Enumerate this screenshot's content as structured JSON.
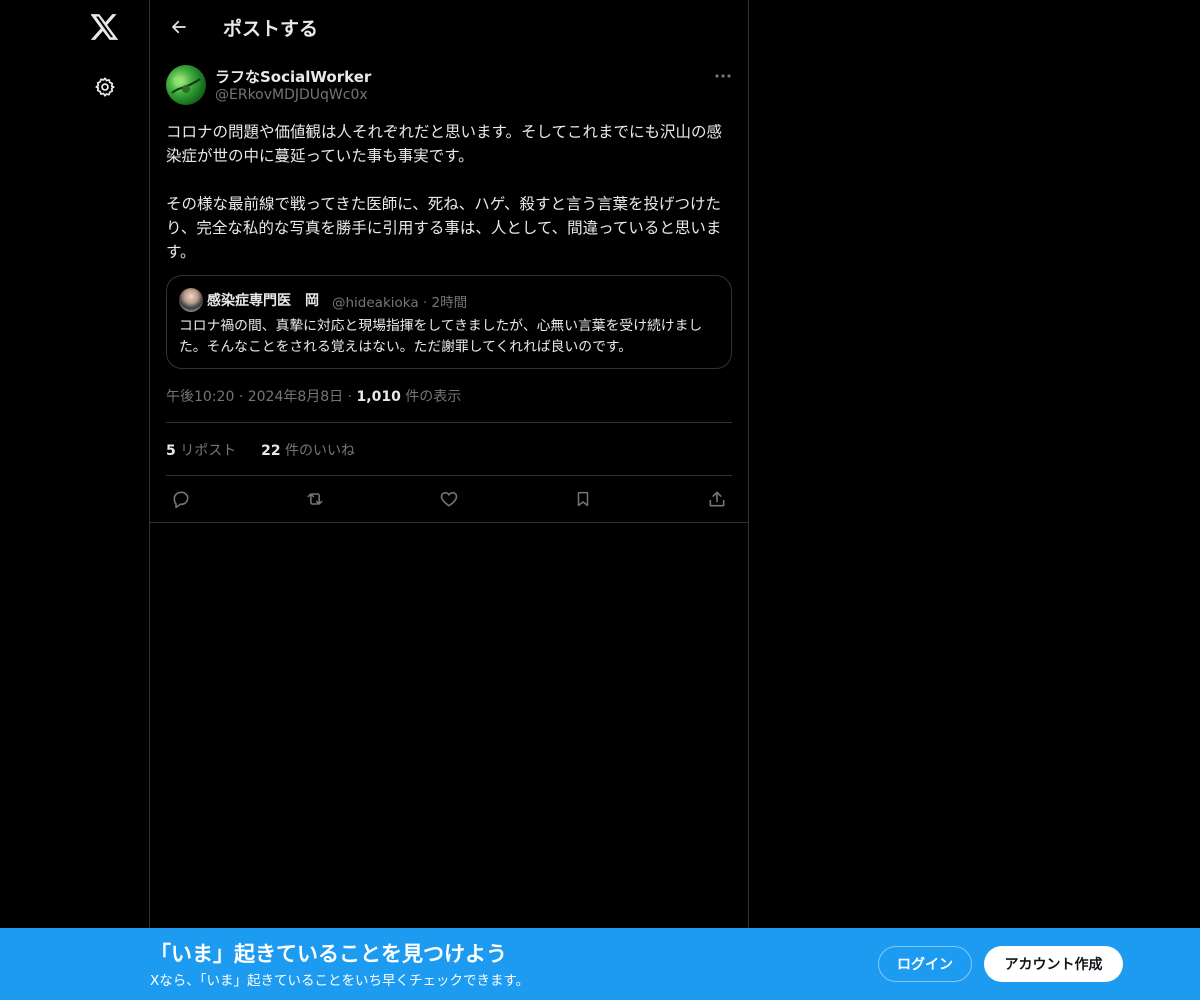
{
  "header": {
    "title": "ポストする"
  },
  "post": {
    "display_name": "ラフなSocialWorker",
    "handle": "@ERkovMDJDUqWc0x",
    "text": "コロナの問題や価値観は人それぞれだと思います。そしてこれまでにも沢山の感染症が世の中に蔓延っていた事も事実です。\n\nその様な最前線で戦ってきた医師に、死ね、ハゲ、殺すと言う言葉を投げつけたり、完全な私的な写真を勝手に引用する事は、人として、間違っていると思います。",
    "quote": {
      "name": "感染症専門医　岡",
      "handle": "@hideakioka",
      "time": "2時間",
      "text": "コロナ禍の間、真摯に対応と現場指揮をしてきましたが、心無い言葉を受け続けました。そんなことをされる覚えはない。ただ謝罪してくれれば良いのです。"
    },
    "time": "午後10:20",
    "date": "2024年8月8日",
    "views_count": "1,010",
    "views_label": "件の表示",
    "reposts_count": "5",
    "reposts_label": "リポスト",
    "likes_count": "22",
    "likes_label": "件のいいね"
  },
  "banner": {
    "title": "「いま」起きていることを見つけよう",
    "subtitle": "Xなら、「いま」起きていることをいち早くチェックできます。",
    "login_label": "ログイン",
    "signup_label": "アカウント作成"
  },
  "colors": {
    "background": "#000000",
    "text": "#e7e9ea",
    "muted": "#71767b",
    "border": "#2f3336",
    "accent": "#1d9bf0"
  },
  "icons": [
    "x-logo-icon",
    "gear-icon",
    "back-arrow-icon",
    "more-icon",
    "reply-icon",
    "repost-icon",
    "like-icon",
    "bookmark-icon",
    "share-icon"
  ]
}
